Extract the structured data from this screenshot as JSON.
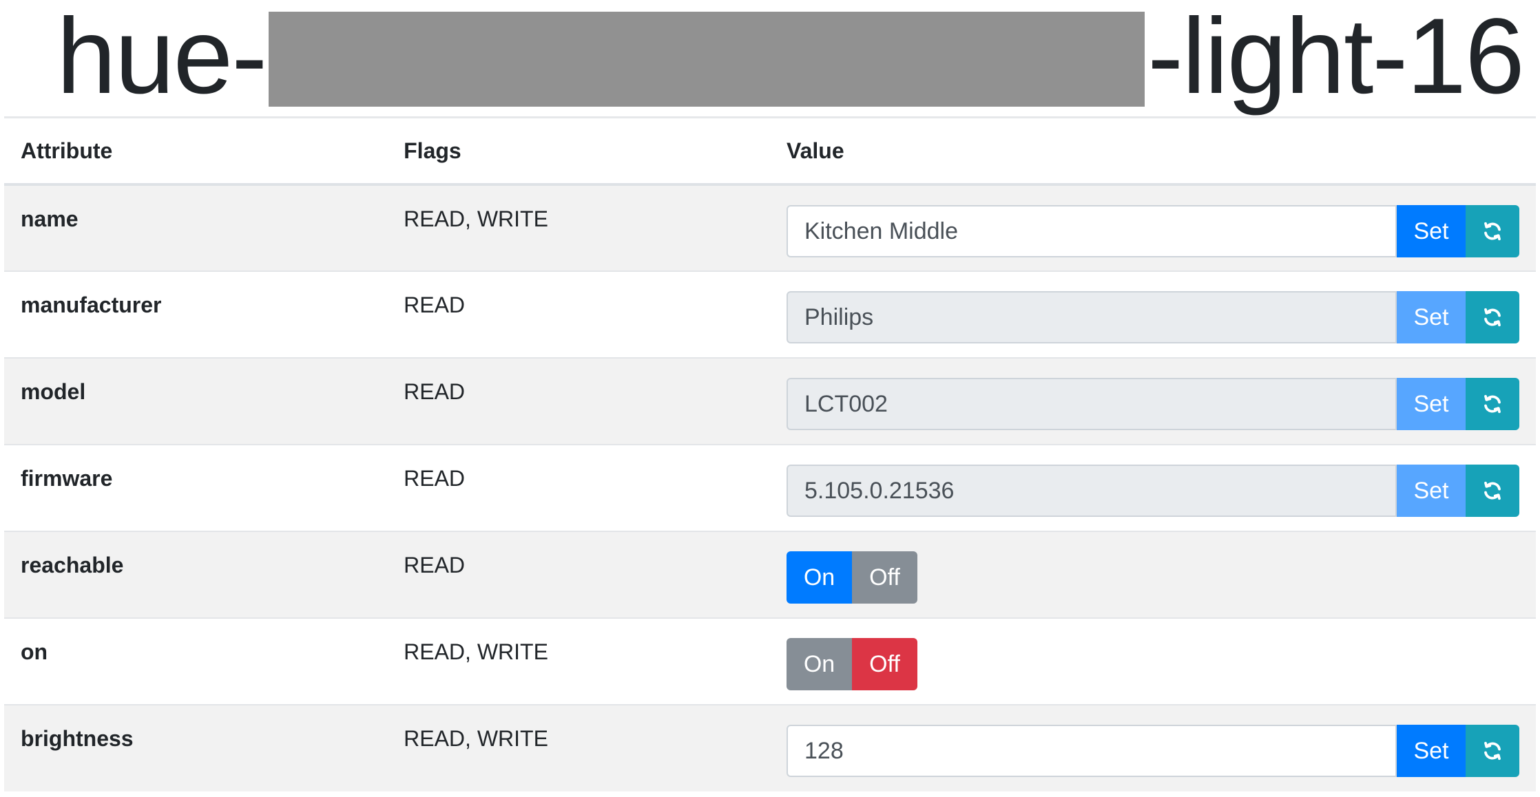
{
  "header": {
    "title_prefix": "hue-",
    "title_suffix": "-light-16"
  },
  "table": {
    "columns": [
      "Attribute",
      "Flags",
      "Value"
    ],
    "rows": [
      {
        "attribute": "name",
        "flags": "READ, WRITE",
        "value": "Kitchen Middle",
        "set_label": "Set"
      },
      {
        "attribute": "manufacturer",
        "flags": "READ",
        "value": "Philips",
        "set_label": "Set"
      },
      {
        "attribute": "model",
        "flags": "READ",
        "value": "LCT002",
        "set_label": "Set"
      },
      {
        "attribute": "firmware",
        "flags": "READ",
        "value": "5.105.0.21536",
        "set_label": "Set"
      },
      {
        "attribute": "reachable",
        "flags": "READ",
        "on_label": "On",
        "off_label": "Off",
        "state": "On"
      },
      {
        "attribute": "on",
        "flags": "READ, WRITE",
        "on_label": "On",
        "off_label": "Off",
        "state": "Off"
      },
      {
        "attribute": "brightness",
        "flags": "READ, WRITE",
        "value": "128",
        "set_label": "Set"
      }
    ]
  },
  "icons": {
    "refresh": "refresh-icon"
  },
  "colors": {
    "primary": "#007bff",
    "primary_disabled": "#57a6ff",
    "info": "#17a2b8",
    "secondary": "#868e96",
    "danger": "#dc3545",
    "redaction": "#919191"
  }
}
